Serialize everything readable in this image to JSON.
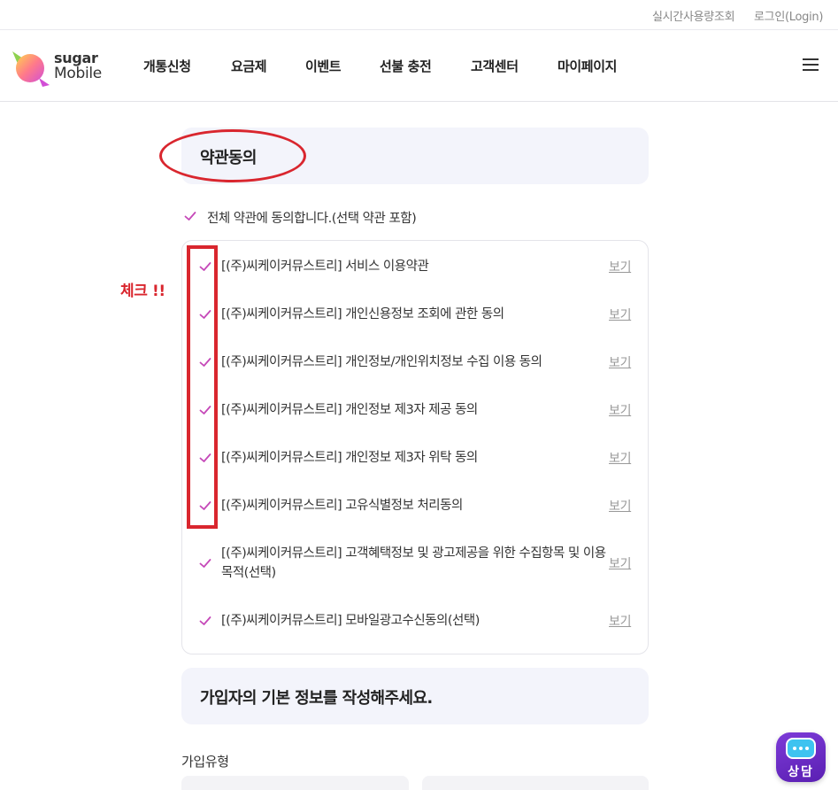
{
  "util_links": {
    "usage": "실시간사용량조회",
    "login": "로그인(Login)"
  },
  "logo": {
    "line1": "sugar",
    "line2": "Mobile"
  },
  "nav": {
    "items": [
      "개통신청",
      "요금제",
      "이벤트",
      "선불 충전",
      "고객센터",
      "마이페이지"
    ]
  },
  "terms_section": {
    "title": "약관동의",
    "all_agree": "전체 약관에 동의합니다.(선택 약관 포함)",
    "view_label": "보기",
    "items": [
      "[(주)씨케이커뮤스트리] 서비스 이용약관",
      "[(주)씨케이커뮤스트리] 개인신용정보 조회에 관한 동의",
      "[(주)씨케이커뮤스트리] 개인정보/개인위치정보 수집 이용 동의",
      "[(주)씨케이커뮤스트리] 개인정보 제3자 제공 동의",
      "[(주)씨케이커뮤스트리] 개인정보 제3자 위탁 동의",
      "[(주)씨케이커뮤스트리] 고유식별정보 처리동의",
      "[(주)씨케이커뮤스트리] 고객혜택정보 및 광고제공을 위한 수집항목 및 이용목적(선택)",
      "[(주)씨케이커뮤스트리] 모바일광고수신동의(선택)"
    ]
  },
  "annotation": {
    "note": "체크 !!"
  },
  "info_section": {
    "title": "가입자의 기본 정보를 작성해주세요.",
    "join_type_label": "가입유형"
  },
  "chat": {
    "label": "상담"
  },
  "colors": {
    "check": "#c548b8",
    "annotation": "#d9262e",
    "section_bg": "#f3f4fb",
    "chat_bg": "#6a2bc4"
  }
}
